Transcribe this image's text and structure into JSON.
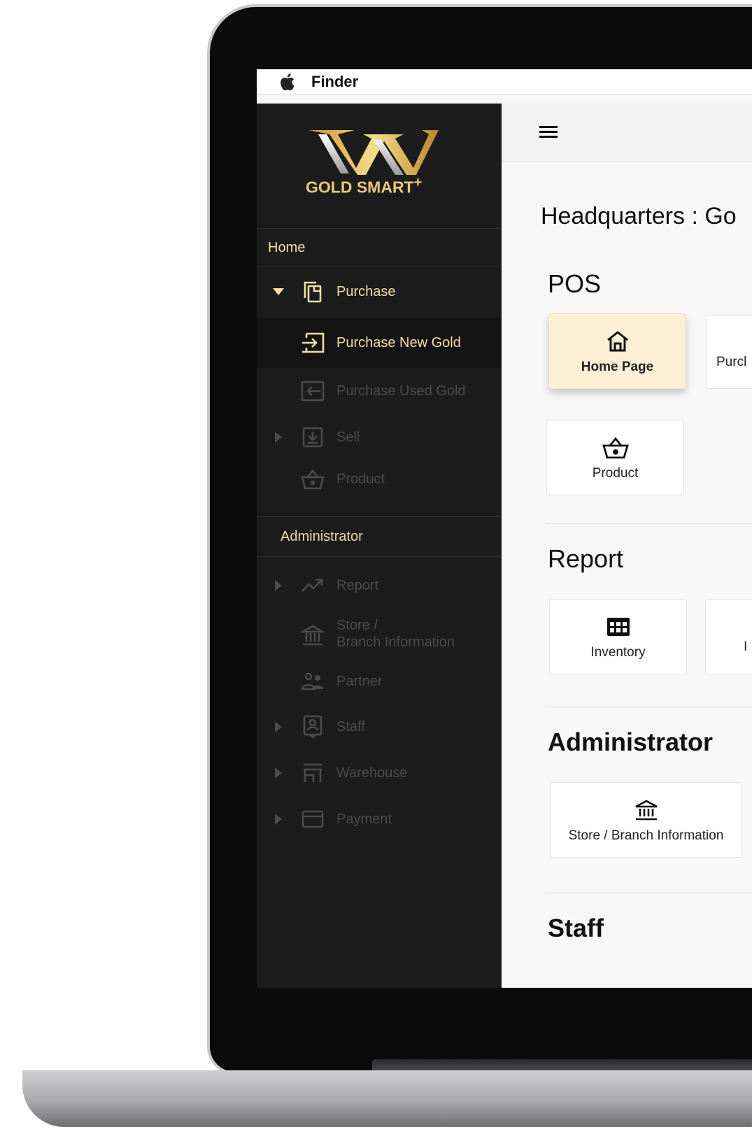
{
  "menubar": {
    "app_name": "Finder",
    "apple_icon": "apple-icon"
  },
  "sidebar": {
    "brand": "GOLD SMART",
    "brand_plus": "+",
    "sections": {
      "home": "Home",
      "administrator": "Administrator"
    },
    "items": [
      {
        "label": "Purchase",
        "icon": "copy-icon",
        "state": "expanded"
      },
      {
        "label": "Purchase New Gold",
        "icon": "import-icon",
        "state": "active"
      },
      {
        "label": "Purchase Used Gold",
        "icon": "exchange-icon",
        "state": "normal"
      },
      {
        "label": "Sell",
        "icon": "download-box-icon",
        "state": "collapsed"
      },
      {
        "label": "Product",
        "icon": "basket-icon",
        "state": "normal"
      },
      {
        "label": "Report",
        "icon": "trending-up-icon",
        "state": "collapsed"
      },
      {
        "label": "Store /",
        "label2": "Branch Information",
        "icon": "bank-icon",
        "state": "normal"
      },
      {
        "label": "Partner",
        "icon": "people-icon",
        "state": "normal"
      },
      {
        "label": "Staff",
        "icon": "badge-icon",
        "state": "collapsed"
      },
      {
        "label": "Warehouse",
        "icon": "warehouse-icon",
        "state": "collapsed"
      },
      {
        "label": "Payment",
        "icon": "credit-card-icon",
        "state": "collapsed"
      }
    ]
  },
  "main": {
    "page_title": "Headquarters : Go",
    "sections": {
      "pos": "POS",
      "report": "Report",
      "administrator": "Administrator",
      "staff": "Staff"
    },
    "tiles": {
      "home_page": "Home Page",
      "purchase_partial": "Purcl",
      "product": "Product",
      "inventory": "Inventory",
      "report_partial": "I",
      "store_branch": "Store / Branch Information"
    }
  },
  "colors": {
    "sidebar_bg": "#1c1c1c",
    "accent_gold": "#f3dfa6",
    "highlight_tile": "#fbefd6"
  }
}
